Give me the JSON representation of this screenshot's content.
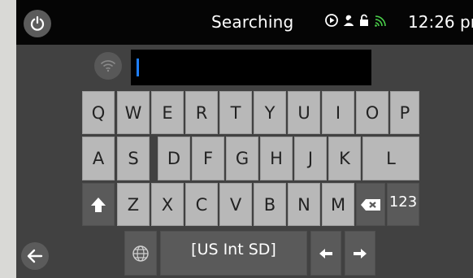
{
  "status": {
    "title": "Searching",
    "time": "12:26 pm",
    "icons": [
      "power-icon",
      "play-circle-icon",
      "user-icon",
      "lock-icon",
      "wifi-signal-icon"
    ]
  },
  "input": {
    "value": ""
  },
  "keyboard": {
    "row1": [
      "Q",
      "W",
      "E",
      "R",
      "T",
      "Y",
      "U",
      "I",
      "O",
      "P"
    ],
    "row2": [
      "A",
      "S",
      "D",
      "F",
      "G",
      "H",
      "J",
      "K",
      "L"
    ],
    "row3": [
      "Z",
      "X",
      "C",
      "V",
      "B",
      "N",
      "M"
    ],
    "numbers_label": "123",
    "space_label": "[US Int SD]"
  },
  "colors": {
    "screen_bg": "#414141",
    "key_light": "#b8b8b8",
    "key_dark": "#5a5a5a",
    "status_bg": "#050505",
    "caret": "#1e7fff",
    "wifi_green": "#4bd14b"
  }
}
